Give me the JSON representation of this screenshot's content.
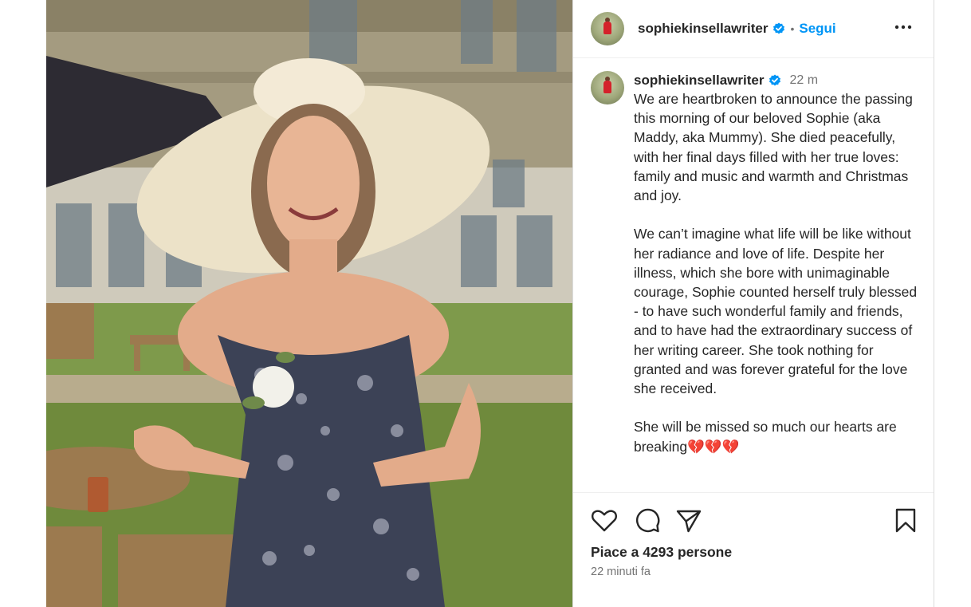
{
  "post": {
    "username": "sophiekinsellawriter",
    "follow_label": "Segui",
    "separator": "•",
    "caption_time": "22 m",
    "caption": "We are heartbroken to announce the passing this morning of our beloved Sophie (aka Maddy, aka Mummy). She died peacefully, with her final days filled with her true loves: family and music and warmth and Christmas and joy.\n\nWe can’t imagine what life will be like without her radiance and love of life. Despite her illness, which she bore with unimaginable courage, Sophie counted herself truly blessed - to have such wonderful family and friends, and to have had the extraordinary success of her writing career. She took nothing for granted and was forever grateful for the love she received.\n\nShe will be missed so much our hearts are breaking💔💔💔",
    "likes_text": "Piace a 4293 persone",
    "posted_time": "22 minuti fa"
  },
  "icons": {
    "verified": "verified-badge-icon",
    "more": "more-options-icon",
    "like": "heart-icon",
    "comment": "comment-icon",
    "share": "share-icon",
    "save": "bookmark-icon"
  },
  "colors": {
    "accent": "#0095f6",
    "text": "#262626",
    "muted": "#737373",
    "border": "#dbdbdb"
  }
}
